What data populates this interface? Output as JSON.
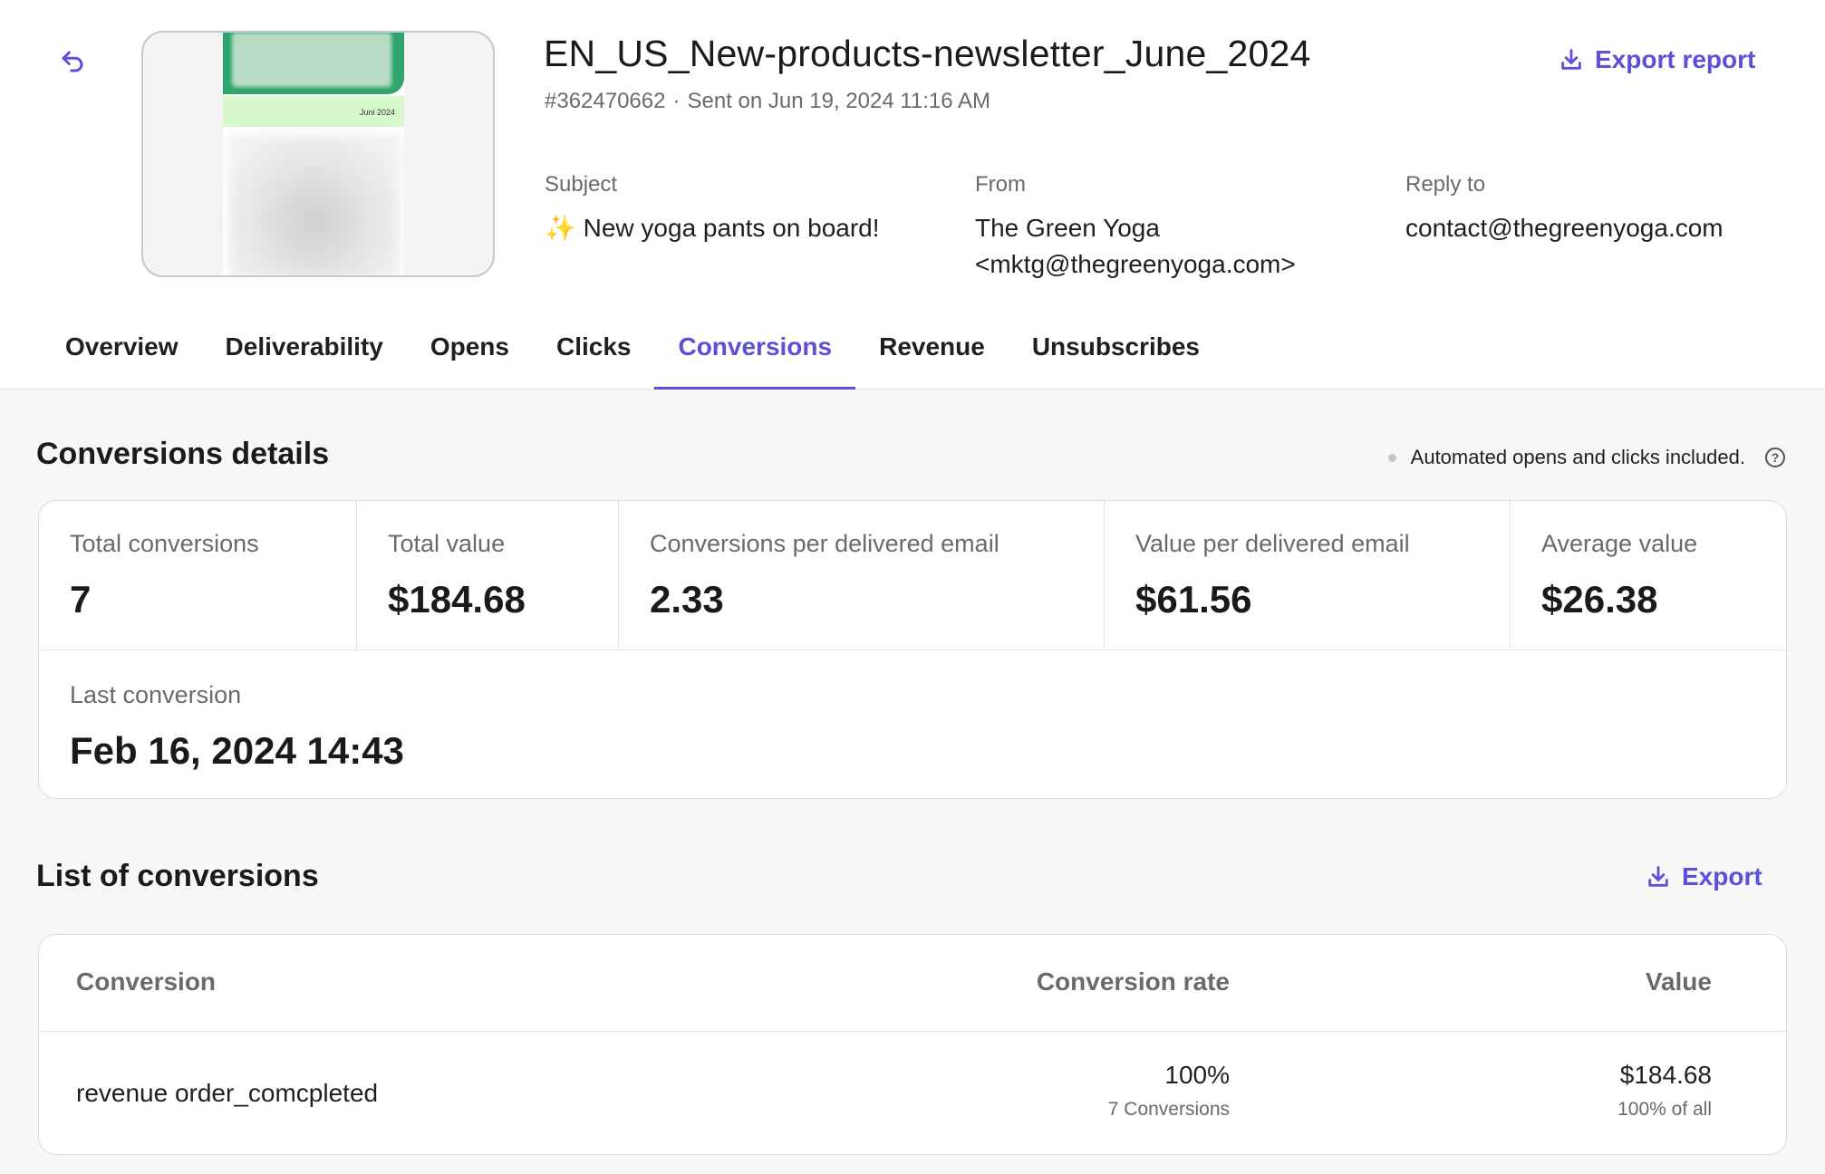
{
  "header": {
    "title": "EN_US_New-products-newsletter_June_2024",
    "campaign_id": "#362470662",
    "sent_text": "Sent on Jun 19, 2024 11:16 AM",
    "export_report_label": "Export report",
    "thumbnail_date": "Juni 2024"
  },
  "info": {
    "subject_label": "Subject",
    "subject_value": "✨ New yoga pants on board!",
    "from_label": "From",
    "from_name": "The Green Yoga",
    "from_email": "<mktg@thegreenyoga.com>",
    "reply_label": "Reply to",
    "reply_value": "contact@thegreenyoga.com"
  },
  "tabs": [
    {
      "label": "Overview",
      "active": false
    },
    {
      "label": "Deliverability",
      "active": false
    },
    {
      "label": "Opens",
      "active": false
    },
    {
      "label": "Clicks",
      "active": false
    },
    {
      "label": "Conversions",
      "active": true
    },
    {
      "label": "Revenue",
      "active": false
    },
    {
      "label": "Unsubscribes",
      "active": false
    }
  ],
  "details": {
    "title": "Conversions details",
    "note": "Automated opens and clicks included.",
    "stats": [
      {
        "label": "Total conversions",
        "value": "7"
      },
      {
        "label": "Total value",
        "value": "$184.68"
      },
      {
        "label": "Conversions per delivered email",
        "value": "2.33"
      },
      {
        "label": "Value per delivered email",
        "value": "$61.56"
      },
      {
        "label": "Average value",
        "value": "$26.38"
      }
    ],
    "last_conversion_label": "Last conversion",
    "last_conversion_value": "Feb 16, 2024 14:43"
  },
  "list": {
    "title": "List of conversions",
    "export_label": "Export",
    "columns": {
      "conversion": "Conversion",
      "rate": "Conversion rate",
      "value": "Value"
    },
    "rows": [
      {
        "conversion": "revenue order_comcpleted",
        "rate": "100%",
        "rate_sub": "7 Conversions",
        "value": "$184.68",
        "value_sub": "100% of all"
      }
    ]
  },
  "colors": {
    "accent": "#5b50d6",
    "text": "#1f1f1f",
    "muted": "#6a6a6a",
    "background": "#f7f7f7"
  },
  "icons": {
    "back": "undo-arrow-icon",
    "export": "download-icon",
    "help": "question-circle-icon"
  }
}
